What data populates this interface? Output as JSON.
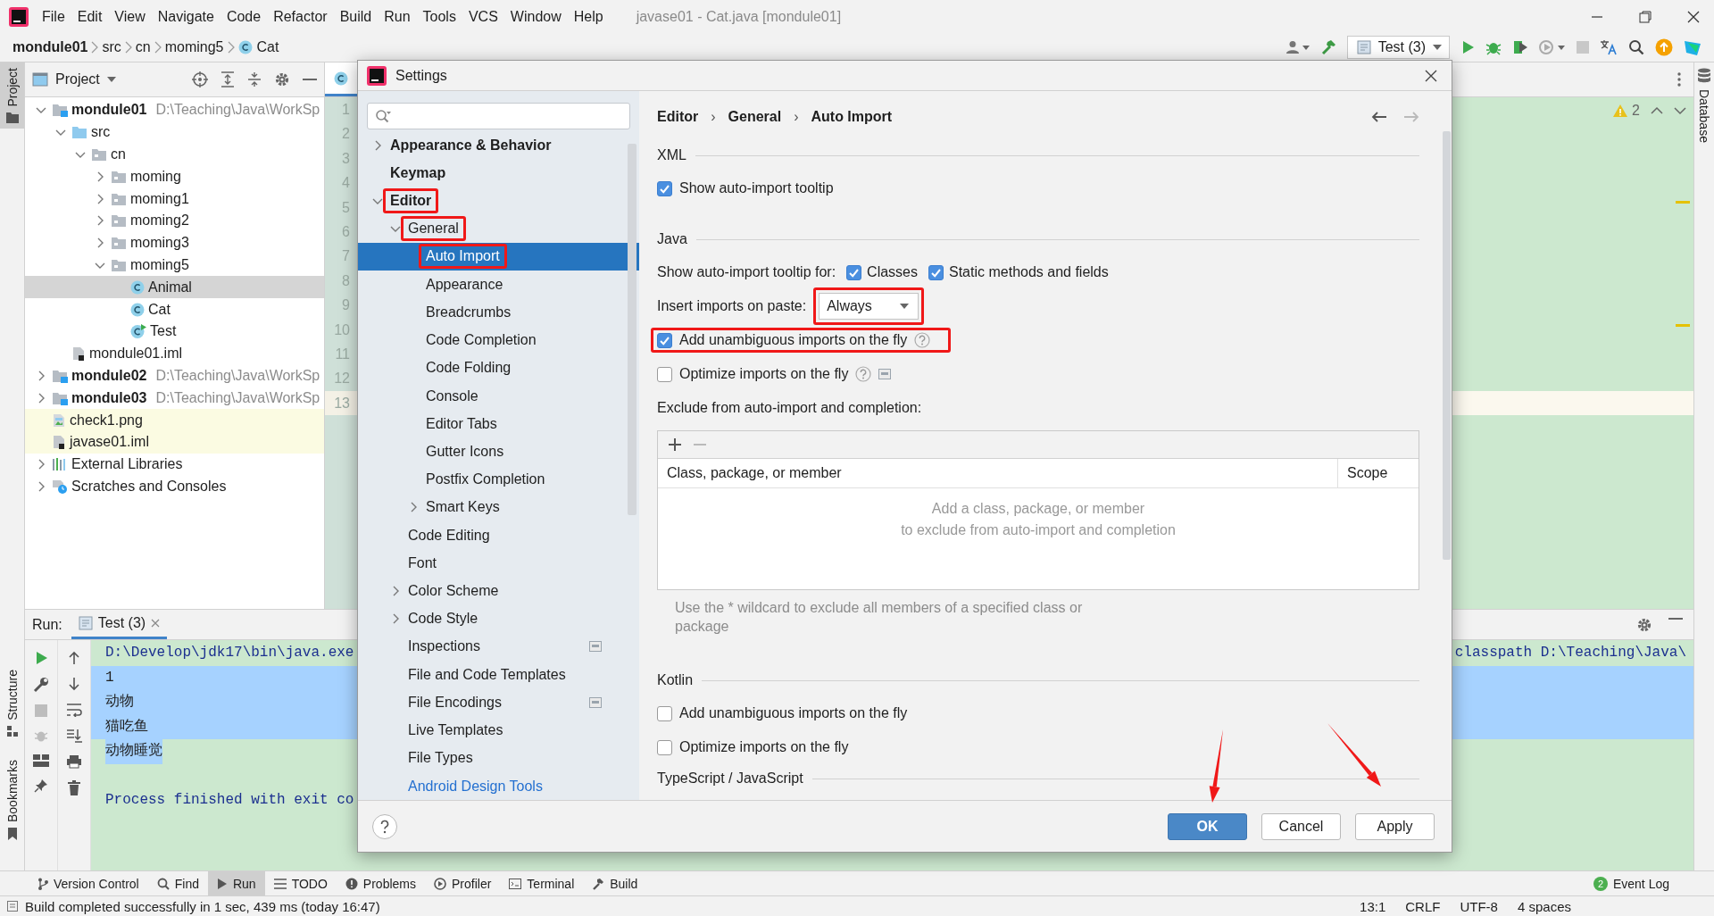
{
  "menu_bar": {
    "menus": [
      "File",
      "Edit",
      "View",
      "Navigate",
      "Code",
      "Refactor",
      "Build",
      "Run",
      "Tools",
      "VCS",
      "Window",
      "Help"
    ],
    "title": "javase01 - Cat.java [mondule01]"
  },
  "nav_bar": {
    "crumbs": [
      {
        "label": "mondule01",
        "kind": "module"
      },
      {
        "label": "src",
        "kind": "plain"
      },
      {
        "label": "cn",
        "kind": "plain"
      },
      {
        "label": "moming5",
        "kind": "plain"
      },
      {
        "label": "Cat",
        "kind": "class"
      }
    ],
    "run_config": "Test (3)"
  },
  "left_stripe": {
    "top": [
      {
        "label": "Project",
        "selected": true
      }
    ],
    "bottom": [
      {
        "label": "Structure",
        "selected": false
      },
      {
        "label": "Bookmarks",
        "selected": false
      }
    ]
  },
  "right_stripe": [
    {
      "label": "Database",
      "selected": false
    }
  ],
  "project": {
    "title": "Project",
    "tree": [
      {
        "label": "mondule01",
        "kind": "module",
        "path": "D:\\Teaching\\Java\\WorkSp",
        "expandable": true,
        "expanded": true,
        "selected": false,
        "highlight": false,
        "children": [
          {
            "label": "src",
            "kind": "source",
            "expandable": true,
            "expanded": true,
            "selected": false,
            "highlight": false,
            "children": [
              {
                "label": "cn",
                "kind": "package",
                "expandable": true,
                "expanded": true,
                "selected": false,
                "highlight": false,
                "children": [
                  {
                    "label": "moming",
                    "kind": "package",
                    "expandable": true,
                    "expanded": false,
                    "selected": false,
                    "highlight": false
                  },
                  {
                    "label": "moming1",
                    "kind": "package",
                    "expandable": true,
                    "expanded": false,
                    "selected": false,
                    "highlight": false
                  },
                  {
                    "label": "moming2",
                    "kind": "package",
                    "expandable": true,
                    "expanded": false,
                    "selected": false,
                    "highlight": false
                  },
                  {
                    "label": "moming3",
                    "kind": "package",
                    "expandable": true,
                    "expanded": false,
                    "selected": false,
                    "highlight": false
                  },
                  {
                    "label": "moming5",
                    "kind": "package",
                    "expandable": true,
                    "expanded": true,
                    "selected": false,
                    "highlight": false,
                    "children": [
                      {
                        "label": "Animal",
                        "kind": "class",
                        "expandable": false,
                        "selected": true,
                        "highlight": false
                      },
                      {
                        "label": "Cat",
                        "kind": "class",
                        "expandable": false,
                        "selected": false,
                        "highlight": false
                      },
                      {
                        "label": "Test",
                        "kind": "runnable",
                        "expandable": false,
                        "selected": false,
                        "highlight": false
                      }
                    ]
                  }
                ]
              }
            ]
          },
          {
            "label": "mondule01.iml",
            "kind": "iml",
            "expandable": false,
            "selected": false,
            "highlight": false
          }
        ]
      },
      {
        "label": "mondule02",
        "kind": "module",
        "path": "D:\\Teaching\\Java\\WorkSp",
        "expandable": true,
        "expanded": false,
        "selected": false,
        "highlight": false
      },
      {
        "label": "mondule03",
        "kind": "module",
        "path": "D:\\Teaching\\Java\\WorkSp",
        "expandable": true,
        "expanded": false,
        "selected": false,
        "highlight": false
      },
      {
        "label": "check1.png",
        "kind": "image",
        "expandable": false,
        "selected": false,
        "highlight": true
      },
      {
        "label": "javase01.iml",
        "kind": "iml",
        "expandable": false,
        "selected": false,
        "highlight": true
      },
      {
        "label": "External Libraries",
        "kind": "libraries",
        "expandable": true,
        "expanded": false,
        "selected": false,
        "highlight": false
      },
      {
        "label": "Scratches and Consoles",
        "kind": "scratches",
        "expandable": true,
        "expanded": false,
        "selected": false,
        "highlight": false
      }
    ]
  },
  "editor": {
    "lines": [
      {
        "number": "1",
        "current": false
      },
      {
        "number": "2",
        "current": false
      },
      {
        "number": "3",
        "current": false
      },
      {
        "number": "4",
        "current": false
      },
      {
        "number": "5",
        "current": false
      },
      {
        "number": "6",
        "current": false
      },
      {
        "number": "7",
        "current": false
      },
      {
        "number": "8",
        "current": false
      },
      {
        "number": "9",
        "current": false
      },
      {
        "number": "10",
        "current": false
      },
      {
        "number": "11",
        "current": false
      },
      {
        "number": "12",
        "current": false
      },
      {
        "number": "13",
        "current": true
      }
    ],
    "warnings": "2"
  },
  "run": {
    "title": "Run:",
    "tab": "Test (3)",
    "lines": [
      {
        "kind": "command",
        "selected": false,
        "texts": [
          "D:\\Develop\\jdk17\\bin\\java.exe",
          "classpath D:\\Teaching\\Java\\"
        ]
      },
      {
        "kind": "output",
        "selected": true,
        "whole_row": true,
        "texts": [
          "1"
        ]
      },
      {
        "kind": "output",
        "selected": true,
        "whole_row": true,
        "texts": [
          "动物"
        ]
      },
      {
        "kind": "output",
        "selected": true,
        "whole_row": true,
        "texts": [
          "猫吃鱼"
        ]
      },
      {
        "kind": "output",
        "selected": true,
        "whole_row": false,
        "texts": [
          "动物睡觉"
        ]
      },
      {
        "kind": "blank"
      },
      {
        "kind": "system",
        "selected": false,
        "texts": [
          "Process finished with exit co"
        ]
      }
    ]
  },
  "tool_windows": [
    {
      "label": "Version Control",
      "kind": "vcs",
      "selected": false
    },
    {
      "label": "Find",
      "kind": "find",
      "selected": false
    },
    {
      "label": "Run",
      "kind": "run",
      "selected": true
    },
    {
      "label": "TODO",
      "kind": "todo",
      "selected": false
    },
    {
      "label": "Problems",
      "kind": "problems",
      "selected": false
    },
    {
      "label": "Profiler",
      "kind": "profiler",
      "selected": false
    },
    {
      "label": "Terminal",
      "kind": "terminal",
      "selected": false
    },
    {
      "label": "Build",
      "kind": "build",
      "selected": false
    }
  ],
  "event_log": {
    "label": "Event Log",
    "count": "2"
  },
  "status_bar": {
    "message": "Build completed successfully in 1 sec, 439 ms (today 16:47)",
    "fields": [
      "13:1",
      "CRLF",
      "UTF-8",
      "4 spaces"
    ]
  },
  "settings": {
    "title": "Settings",
    "tree": [
      {
        "label": "Appearance & Behavior",
        "kind": "page",
        "expandable": true,
        "expanded": false,
        "selected": false,
        "marked": false,
        "scoped": false
      },
      {
        "label": "Keymap",
        "kind": "page",
        "expandable": false,
        "selected": false,
        "marked": false,
        "scoped": false
      },
      {
        "label": "Editor",
        "kind": "page",
        "expandable": true,
        "expanded": true,
        "selected": false,
        "marked": true,
        "scoped": false,
        "children": [
          {
            "label": "General",
            "kind": "page",
            "expandable": true,
            "expanded": true,
            "selected": false,
            "marked": true,
            "scoped": false,
            "children": [
              {
                "label": "Auto Import",
                "kind": "page",
                "expandable": false,
                "selected": true,
                "marked": true,
                "scoped": false
              },
              {
                "label": "Appearance",
                "kind": "page",
                "expandable": false,
                "selected": false,
                "marked": false,
                "scoped": false
              },
              {
                "label": "Breadcrumbs",
                "kind": "page",
                "expandable": false,
                "selected": false,
                "marked": false,
                "scoped": false
              },
              {
                "label": "Code Completion",
                "kind": "page",
                "expandable": false,
                "selected": false,
                "marked": false,
                "scoped": false
              },
              {
                "label": "Code Folding",
                "kind": "page",
                "expandable": false,
                "selected": false,
                "marked": false,
                "scoped": false
              },
              {
                "label": "Console",
                "kind": "page",
                "expandable": false,
                "selected": false,
                "marked": false,
                "scoped": false
              },
              {
                "label": "Editor Tabs",
                "kind": "page",
                "expandable": false,
                "selected": false,
                "marked": false,
                "scoped": false
              },
              {
                "label": "Gutter Icons",
                "kind": "page",
                "expandable": false,
                "selected": false,
                "marked": false,
                "scoped": false
              },
              {
                "label": "Postfix Completion",
                "kind": "page",
                "expandable": false,
                "selected": false,
                "marked": false,
                "scoped": false
              },
              {
                "label": "Smart Keys",
                "kind": "page",
                "expandable": true,
                "expanded": false,
                "selected": false,
                "marked": false,
                "scoped": false
              }
            ]
          },
          {
            "label": "Code Editing",
            "kind": "page",
            "expandable": false,
            "selected": false,
            "marked": false,
            "scoped": false
          },
          {
            "label": "Font",
            "kind": "page",
            "expandable": false,
            "selected": false,
            "marked": false,
            "scoped": false
          },
          {
            "label": "Color Scheme",
            "kind": "page",
            "expandable": true,
            "expanded": false,
            "selected": false,
            "marked": false,
            "scoped": false
          },
          {
            "label": "Code Style",
            "kind": "page",
            "expandable": true,
            "expanded": false,
            "selected": false,
            "marked": false,
            "scoped": false
          },
          {
            "label": "Inspections",
            "kind": "page",
            "expandable": false,
            "selected": false,
            "marked": false,
            "scoped": true
          },
          {
            "label": "File and Code Templates",
            "kind": "page",
            "expandable": false,
            "selected": false,
            "marked": false,
            "scoped": false
          },
          {
            "label": "File Encodings",
            "kind": "page",
            "expandable": false,
            "selected": false,
            "marked": false,
            "scoped": true
          },
          {
            "label": "Live Templates",
            "kind": "page",
            "expandable": false,
            "selected": false,
            "marked": false,
            "scoped": false
          },
          {
            "label": "File Types",
            "kind": "page",
            "expandable": false,
            "selected": false,
            "marked": false,
            "scoped": false
          },
          {
            "label": "Android Design Tools",
            "kind": "plugin",
            "expandable": false,
            "selected": false,
            "marked": false,
            "scoped": false
          }
        ]
      }
    ],
    "breadcrumb": [
      {
        "text": "Editor",
        "kind": "crumb"
      },
      {
        "text": "›",
        "kind": "separator"
      },
      {
        "text": "General",
        "kind": "crumb"
      },
      {
        "text": "›",
        "kind": "separator"
      },
      {
        "text": "Auto Import",
        "kind": "crumb"
      }
    ],
    "nav_arrows": [
      {
        "kind": "back",
        "disabled": false
      },
      {
        "kind": "forward",
        "disabled": true
      }
    ],
    "sections": [
      {
        "title": "XML",
        "options": [
          {
            "kind": "checkbox",
            "label": "Show auto-import tooltip",
            "checked": true,
            "marked": false,
            "help": false,
            "scoped": false
          }
        ]
      },
      {
        "title": "Java",
        "options": [
          {
            "kind": "checkbox-group",
            "label": "Show auto-import tooltip for:",
            "boxes": [
              {
                "label": "Classes",
                "checked": true
              },
              {
                "label": "Static methods and fields",
                "checked": true
              }
            ]
          },
          {
            "kind": "dropdown",
            "label": "Insert imports on paste:",
            "value": "Always",
            "marked": true
          },
          {
            "kind": "checkbox",
            "label": "Add unambiguous imports on the fly",
            "checked": true,
            "marked": true,
            "help": true,
            "scoped": false
          },
          {
            "kind": "checkbox",
            "label": "Optimize imports on the fly",
            "checked": false,
            "marked": false,
            "help": true,
            "scoped": true
          },
          {
            "kind": "label",
            "label": "Exclude from auto-import and completion:"
          },
          {
            "kind": "table",
            "tools": [
              {
                "kind": "add",
                "disabled": false
              },
              {
                "kind": "remove",
                "disabled": true
              }
            ],
            "columns": [
              "Class, package, or member",
              "Scope"
            ],
            "empty_text": [
              "Add a class, package, or member",
              "to exclude from auto-import and completion"
            ]
          },
          {
            "kind": "hint",
            "label": "Use the * wildcard to exclude all members of a specified class or package"
          }
        ]
      },
      {
        "title": "Kotlin",
        "options": [
          {
            "kind": "checkbox",
            "label": "Add unambiguous imports on the fly",
            "checked": false,
            "marked": false,
            "help": false,
            "scoped": false
          },
          {
            "kind": "checkbox",
            "label": "Optimize imports on the fly",
            "checked": false,
            "marked": false,
            "help": false,
            "scoped": false
          }
        ]
      },
      {
        "title": "TypeScript / JavaScript"
      }
    ],
    "buttons": [
      {
        "label": "OK",
        "kind": "default",
        "marked": true
      },
      {
        "label": "Cancel",
        "kind": "normal",
        "marked": false
      },
      {
        "label": "Apply",
        "kind": "normal",
        "marked": true
      }
    ]
  }
}
